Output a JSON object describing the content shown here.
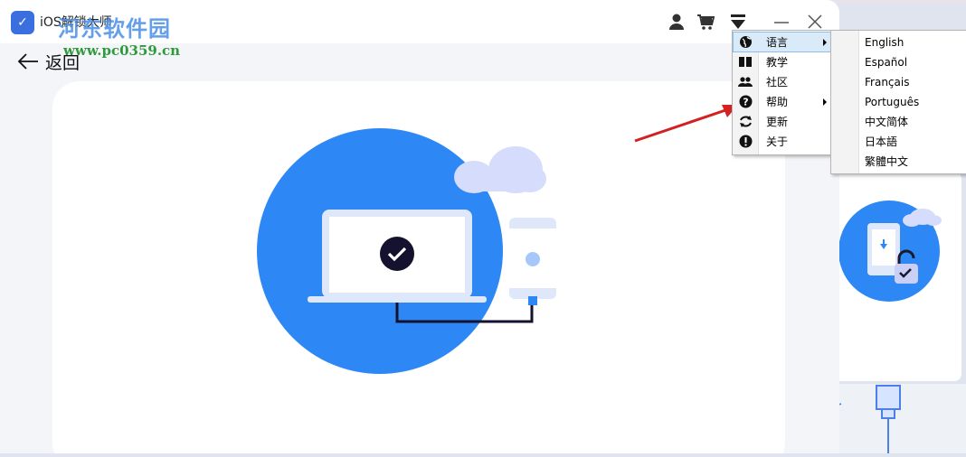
{
  "window": {
    "title": "iOS解锁大师",
    "back_label": "返回"
  },
  "watermark": {
    "title": "河东软件园",
    "url": "www.pc0359.cn"
  },
  "titlebar_icons": [
    "user-icon",
    "cart-icon",
    "menu-dropdown-icon",
    "minimize-icon",
    "close-icon"
  ],
  "menu": {
    "items": [
      {
        "label": "语言",
        "icon": "globe-icon",
        "has_submenu": true,
        "active": true
      },
      {
        "label": "教学",
        "icon": "book-icon",
        "has_submenu": false
      },
      {
        "label": "社区",
        "icon": "community-icon",
        "has_submenu": false
      },
      {
        "label": "帮助",
        "icon": "help-icon",
        "has_submenu": true
      },
      {
        "label": "更新",
        "icon": "refresh-icon",
        "has_submenu": false
      },
      {
        "label": "关于",
        "icon": "info-icon",
        "has_submenu": false
      }
    ]
  },
  "language_submenu": {
    "items": [
      "English",
      "Español",
      "Français",
      "Português",
      "中文简体",
      "日本語",
      "繁體中文"
    ]
  },
  "colors": {
    "accent": "#2d88f5",
    "annotation_arrow": "#d42020",
    "menu_highlight": "#d9ebf9"
  }
}
